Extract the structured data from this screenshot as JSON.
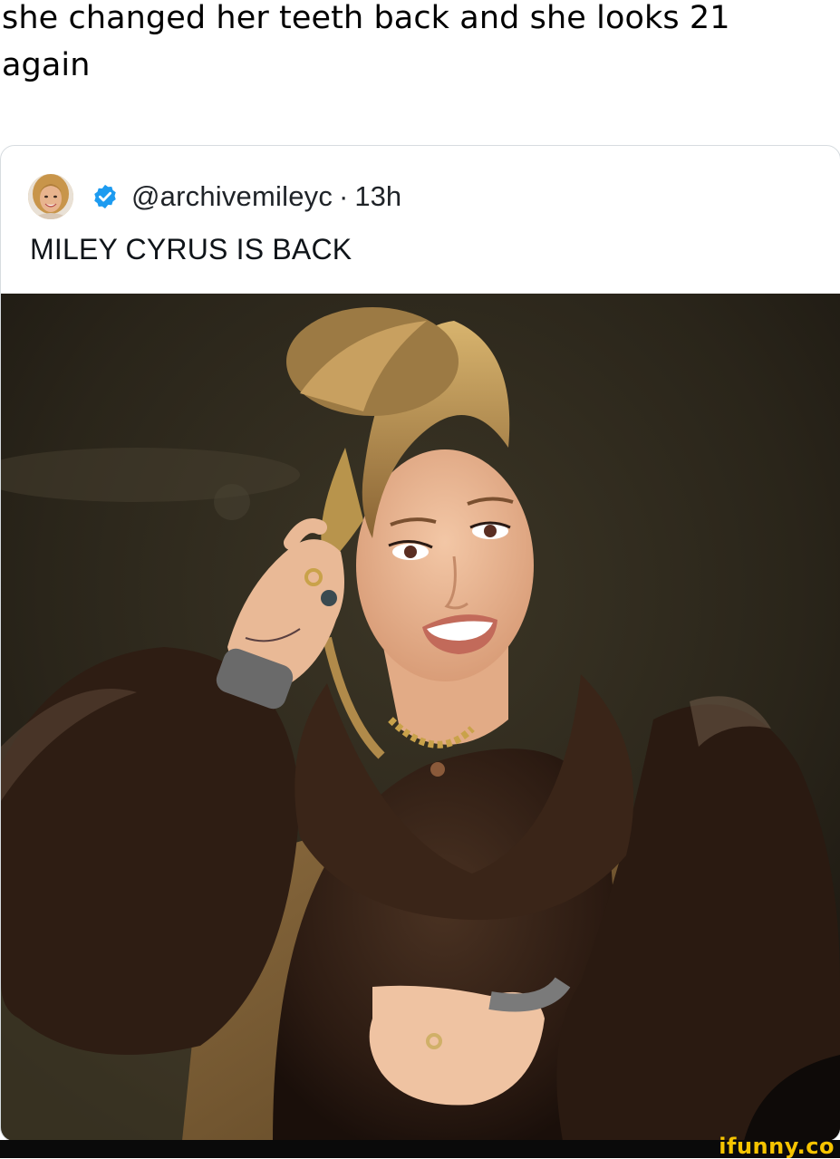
{
  "post": {
    "caption": "she changed her teeth back and she looks 21 again"
  },
  "tweet": {
    "handle": "@archivemileyc",
    "separator": "·",
    "time": "13h",
    "text": "MILEY CYRUS IS BACK",
    "verified_color": "#1d9bf0"
  },
  "watermark": {
    "text": "ifunny.co",
    "color": "#f5c400"
  }
}
